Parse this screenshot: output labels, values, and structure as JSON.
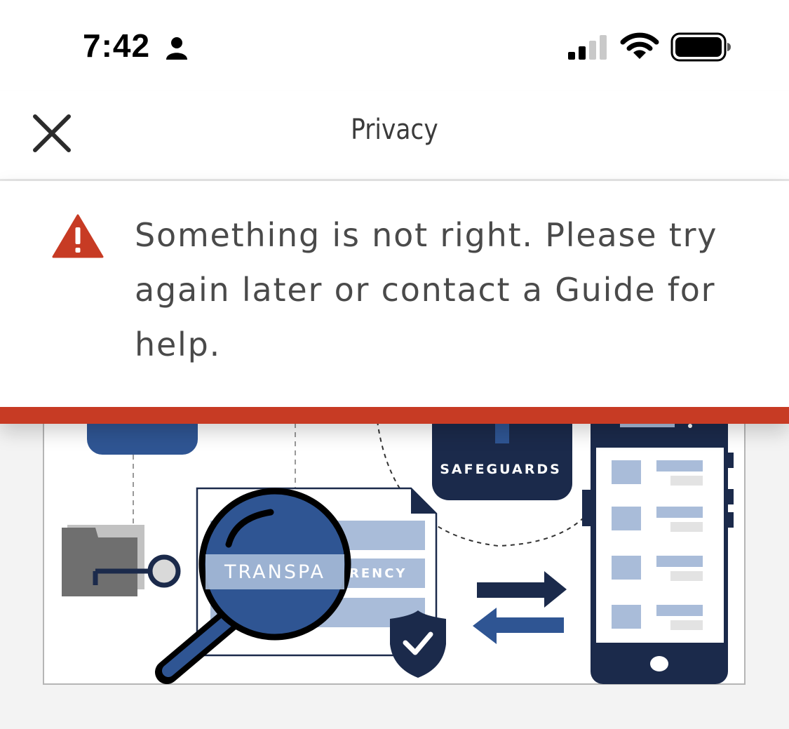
{
  "status_bar": {
    "time": "7:42",
    "icons": [
      "person-icon",
      "cellular-signal-icon",
      "wifi-icon",
      "battery-icon"
    ]
  },
  "nav": {
    "title": "Privacy",
    "close_icon": "close-icon"
  },
  "alert": {
    "icon": "warning-icon",
    "message": "Something is not right. Please try again later or contact a Guide for help."
  },
  "illustration": {
    "safeguards_label": "SAFEGUARDS",
    "transparency_label_magnified": "TRANSPA",
    "transparency_label_rest": "RENCY"
  },
  "colors": {
    "alert_accent": "#c73b24",
    "navy": "#1b2a4b",
    "blue": "#2f5593",
    "light_blue": "#a9bcd9"
  }
}
